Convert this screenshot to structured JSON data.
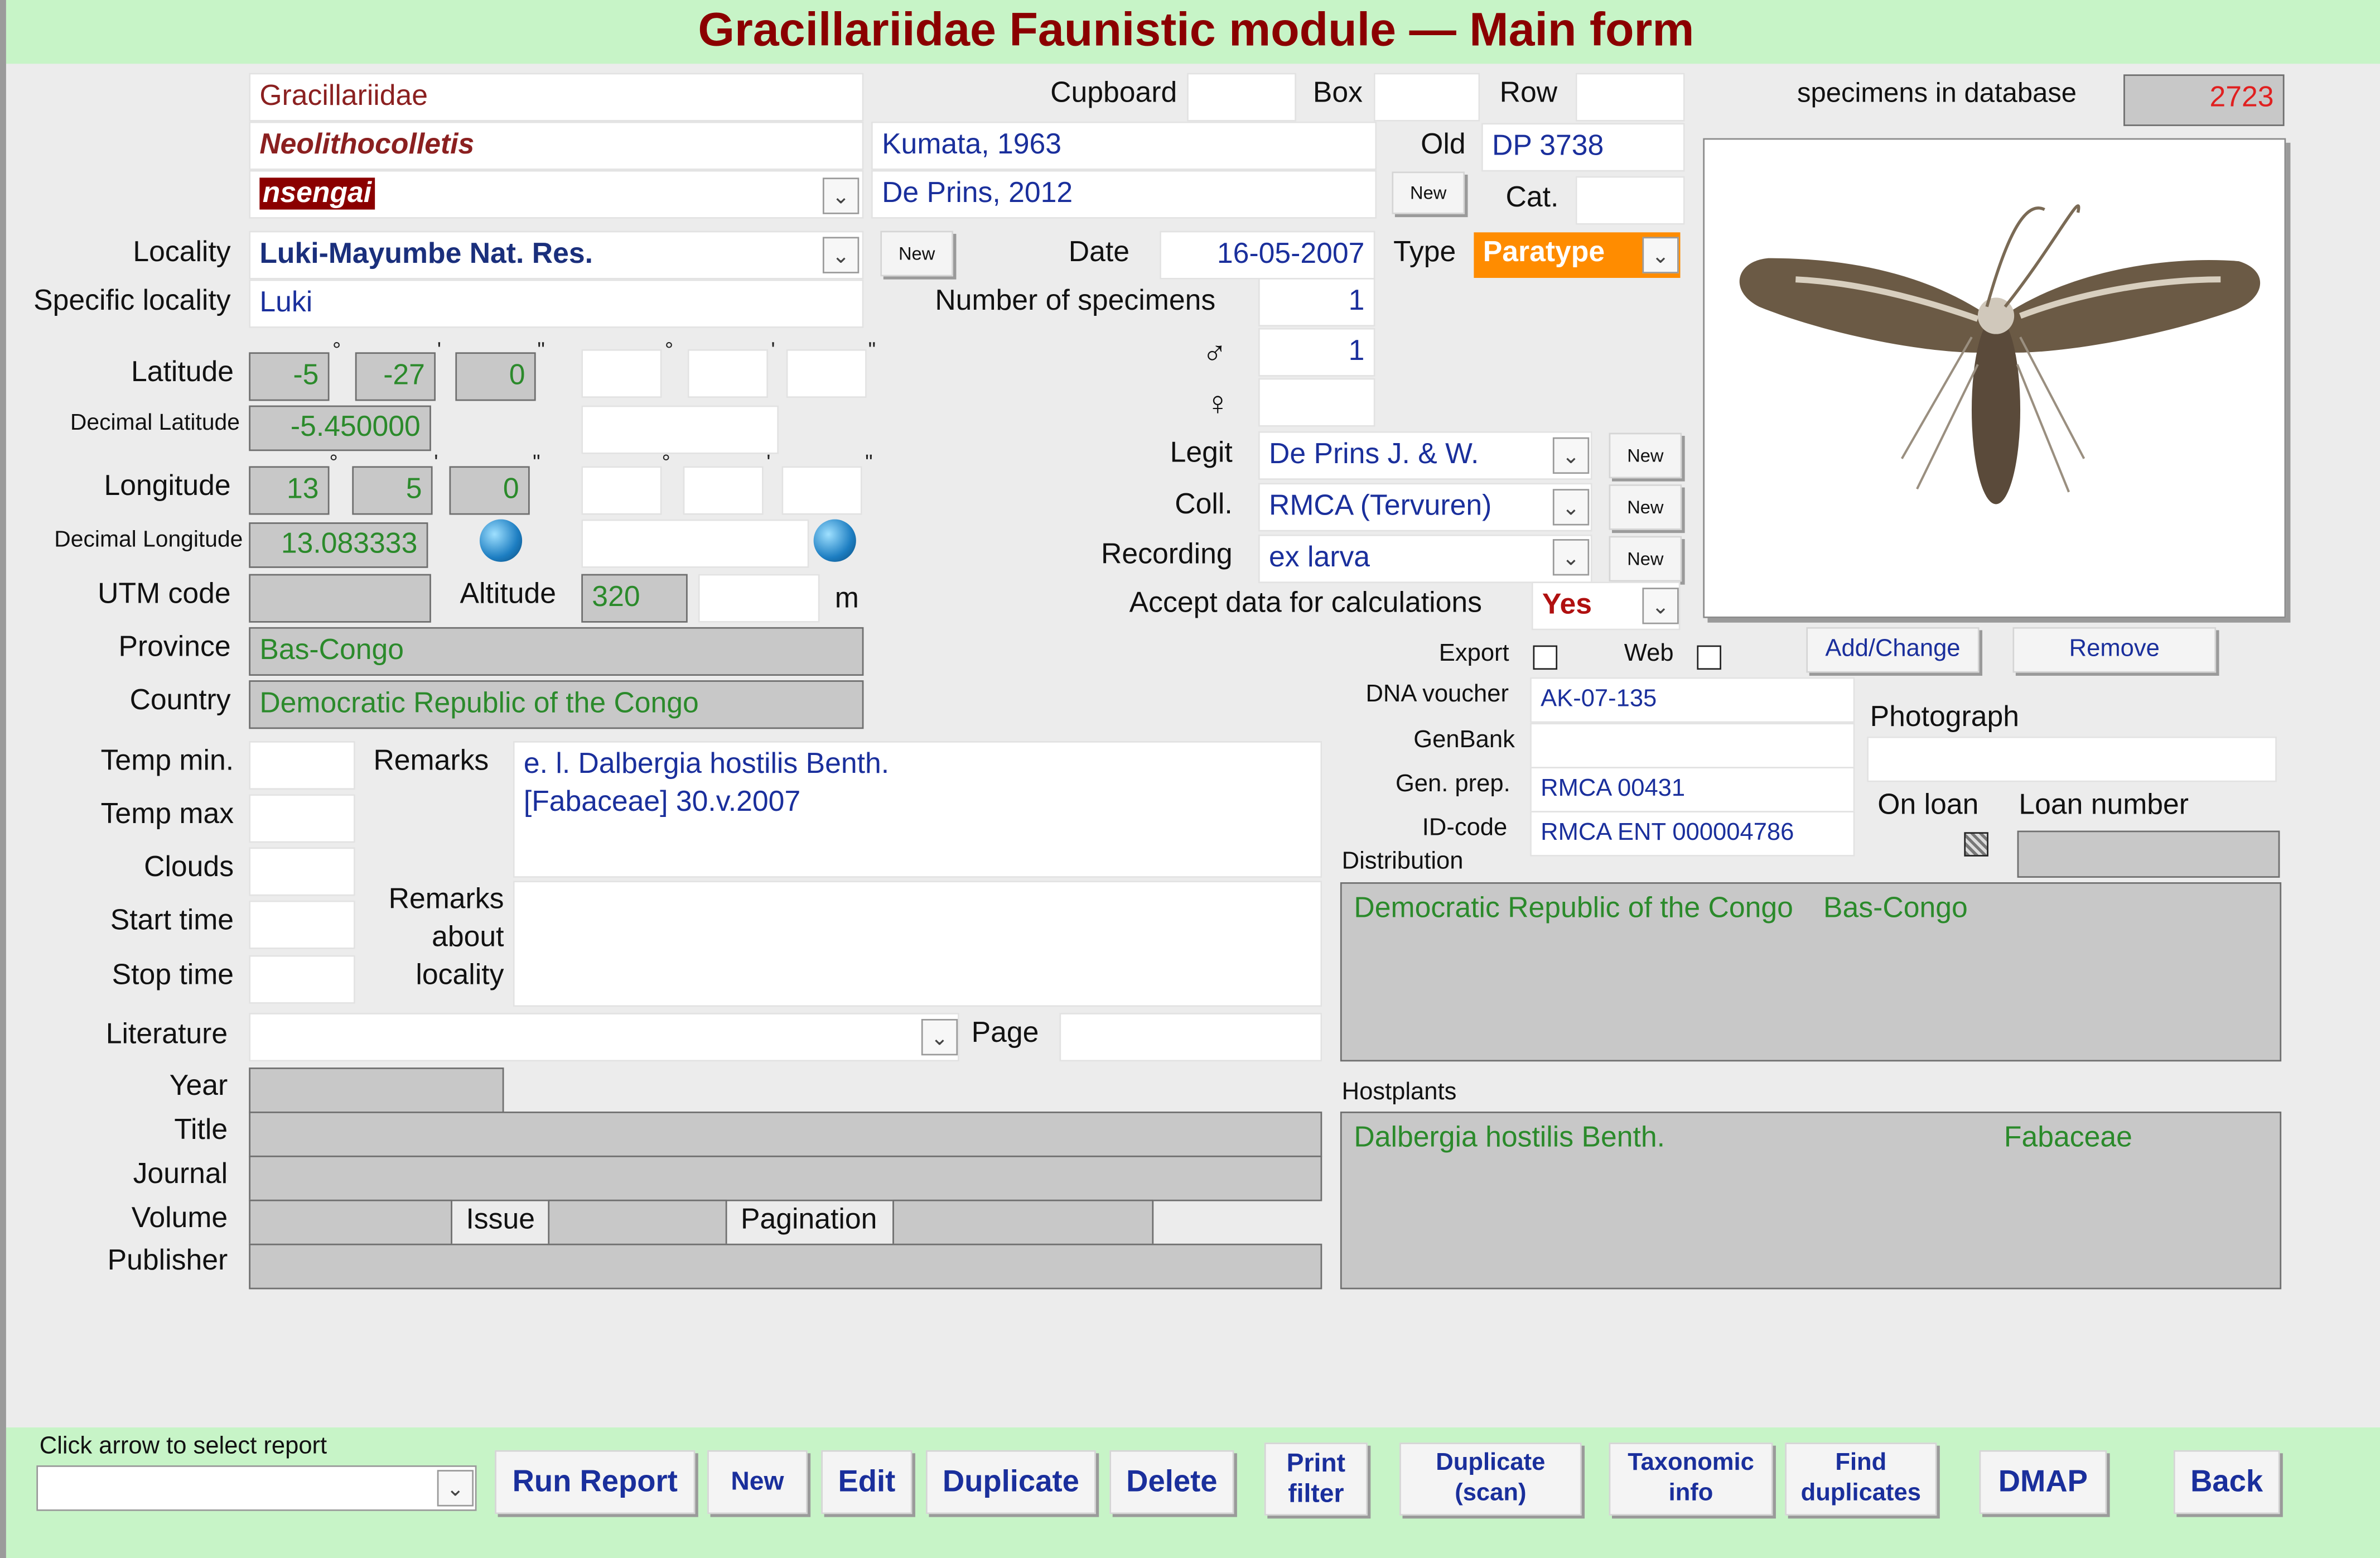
{
  "title": "Gracillariidae Faunistic module — Main form",
  "taxon": {
    "family": "Gracillariidae",
    "genus": "Neolithocolletis",
    "species": "nsengai",
    "genus_author": "Kumata, 1963",
    "species_author": "De Prins, 2012"
  },
  "storage": {
    "cupboard_label": "Cupboard",
    "box_label": "Box",
    "row_label": "Row",
    "old_label": "Old",
    "old_value": "DP 3738",
    "cat_label": "Cat."
  },
  "specimens": {
    "label": "specimens in database",
    "count": "2723"
  },
  "locality": {
    "label": "Locality",
    "value": "Luki-Mayumbe Nat. Res.",
    "specific_label": "Specific locality",
    "specific_value": "Luki"
  },
  "date": {
    "label": "Date",
    "value": "16-05-2007"
  },
  "type": {
    "label": "Type",
    "value": "Paratype"
  },
  "numspec": {
    "label": "Number of specimens",
    "value": "1",
    "male_symbol": "♂",
    "male_value": "1",
    "female_symbol": "♀"
  },
  "coords": {
    "lat_label": "Latitude",
    "lat_deg": "-5",
    "lat_min": "-27",
    "lat_sec": "0",
    "declat_label": "Decimal Latitude",
    "declat_value": "-5.450000",
    "lon_label": "Longitude",
    "lon_deg": "13",
    "lon_min": "5",
    "lon_sec": "0",
    "declon_label": "Decimal Longitude",
    "declon_value": "13.083333",
    "utm_label": "UTM code",
    "alt_label": "Altitude",
    "alt_value": "320",
    "alt_unit": "m",
    "deg_symbol": "°",
    "min_symbol": "'",
    "sec_symbol": "\""
  },
  "province": {
    "label": "Province",
    "value": "Bas-Congo"
  },
  "country": {
    "label": "Country",
    "value": "Democratic Republic of the Congo"
  },
  "legit": {
    "label": "Legit",
    "value": "De Prins J. & W."
  },
  "coll": {
    "label": "Coll.",
    "value": "RMCA (Tervuren)"
  },
  "recording": {
    "label": "Recording",
    "value": "ex larva"
  },
  "accept": {
    "label": "Accept data for calculations",
    "value": "Yes"
  },
  "export_label": "Export",
  "web_label": "Web",
  "dna": {
    "label": "DNA voucher",
    "value": "AK-07-135"
  },
  "genbank": {
    "label": "GenBank"
  },
  "genprep": {
    "label": "Gen. prep.",
    "value": "RMCA 00431"
  },
  "idcode": {
    "label": "ID-code",
    "value": "RMCA ENT 000004786"
  },
  "photo": {
    "label": "Photograph",
    "add_button": "Add/Change",
    "remove_button": "Remove"
  },
  "loan": {
    "on_loan_label": "On loan",
    "number_label": "Loan number"
  },
  "weather": {
    "temp_min": "Temp min.",
    "temp_max": "Temp max",
    "clouds": "Clouds",
    "start": "Start time",
    "stop": "Stop time"
  },
  "remarks": {
    "label": "Remarks",
    "line1": "e. l. Dalbergia hostilis Benth.",
    "line2": "[Fabaceae] 30.v.2007",
    "loc_label1": "Remarks",
    "loc_label2": "about",
    "loc_label3": "locality"
  },
  "distribution": {
    "label": "Distribution",
    "country": "Democratic Republic of the Congo",
    "province": "Bas-Congo"
  },
  "hostplants": {
    "label": "Hostplants",
    "plant": "Dalbergia hostilis Benth.",
    "family": "Fabaceae"
  },
  "literature": {
    "label": "Literature",
    "page_label": "Page",
    "year": "Year",
    "title": "Title",
    "journal": "Journal",
    "volume": "Volume",
    "issue": "Issue",
    "pagination": "Pagination",
    "publisher": "Publisher"
  },
  "new_label": "New",
  "footer": {
    "report_label": "Click arrow to select report",
    "run_report": "Run Report",
    "new": "New",
    "edit": "Edit",
    "duplicate": "Duplicate",
    "delete": "Delete",
    "print_filter_1": "Print",
    "print_filter_2": "filter",
    "dup_scan_1": "Duplicate",
    "dup_scan_2": "(scan)",
    "tax_info_1": "Taxonomic",
    "tax_info_2": "info",
    "find_dup_1": "Find",
    "find_dup_2": "duplicates",
    "dmap": "DMAP",
    "back": "Back"
  },
  "colors": {
    "header_bg": "#c7f4c7",
    "title": "#8b0000",
    "accent_blue": "#1a2f9c",
    "type_bg": "#ff8c00",
    "data_green": "#2b8a2b"
  }
}
